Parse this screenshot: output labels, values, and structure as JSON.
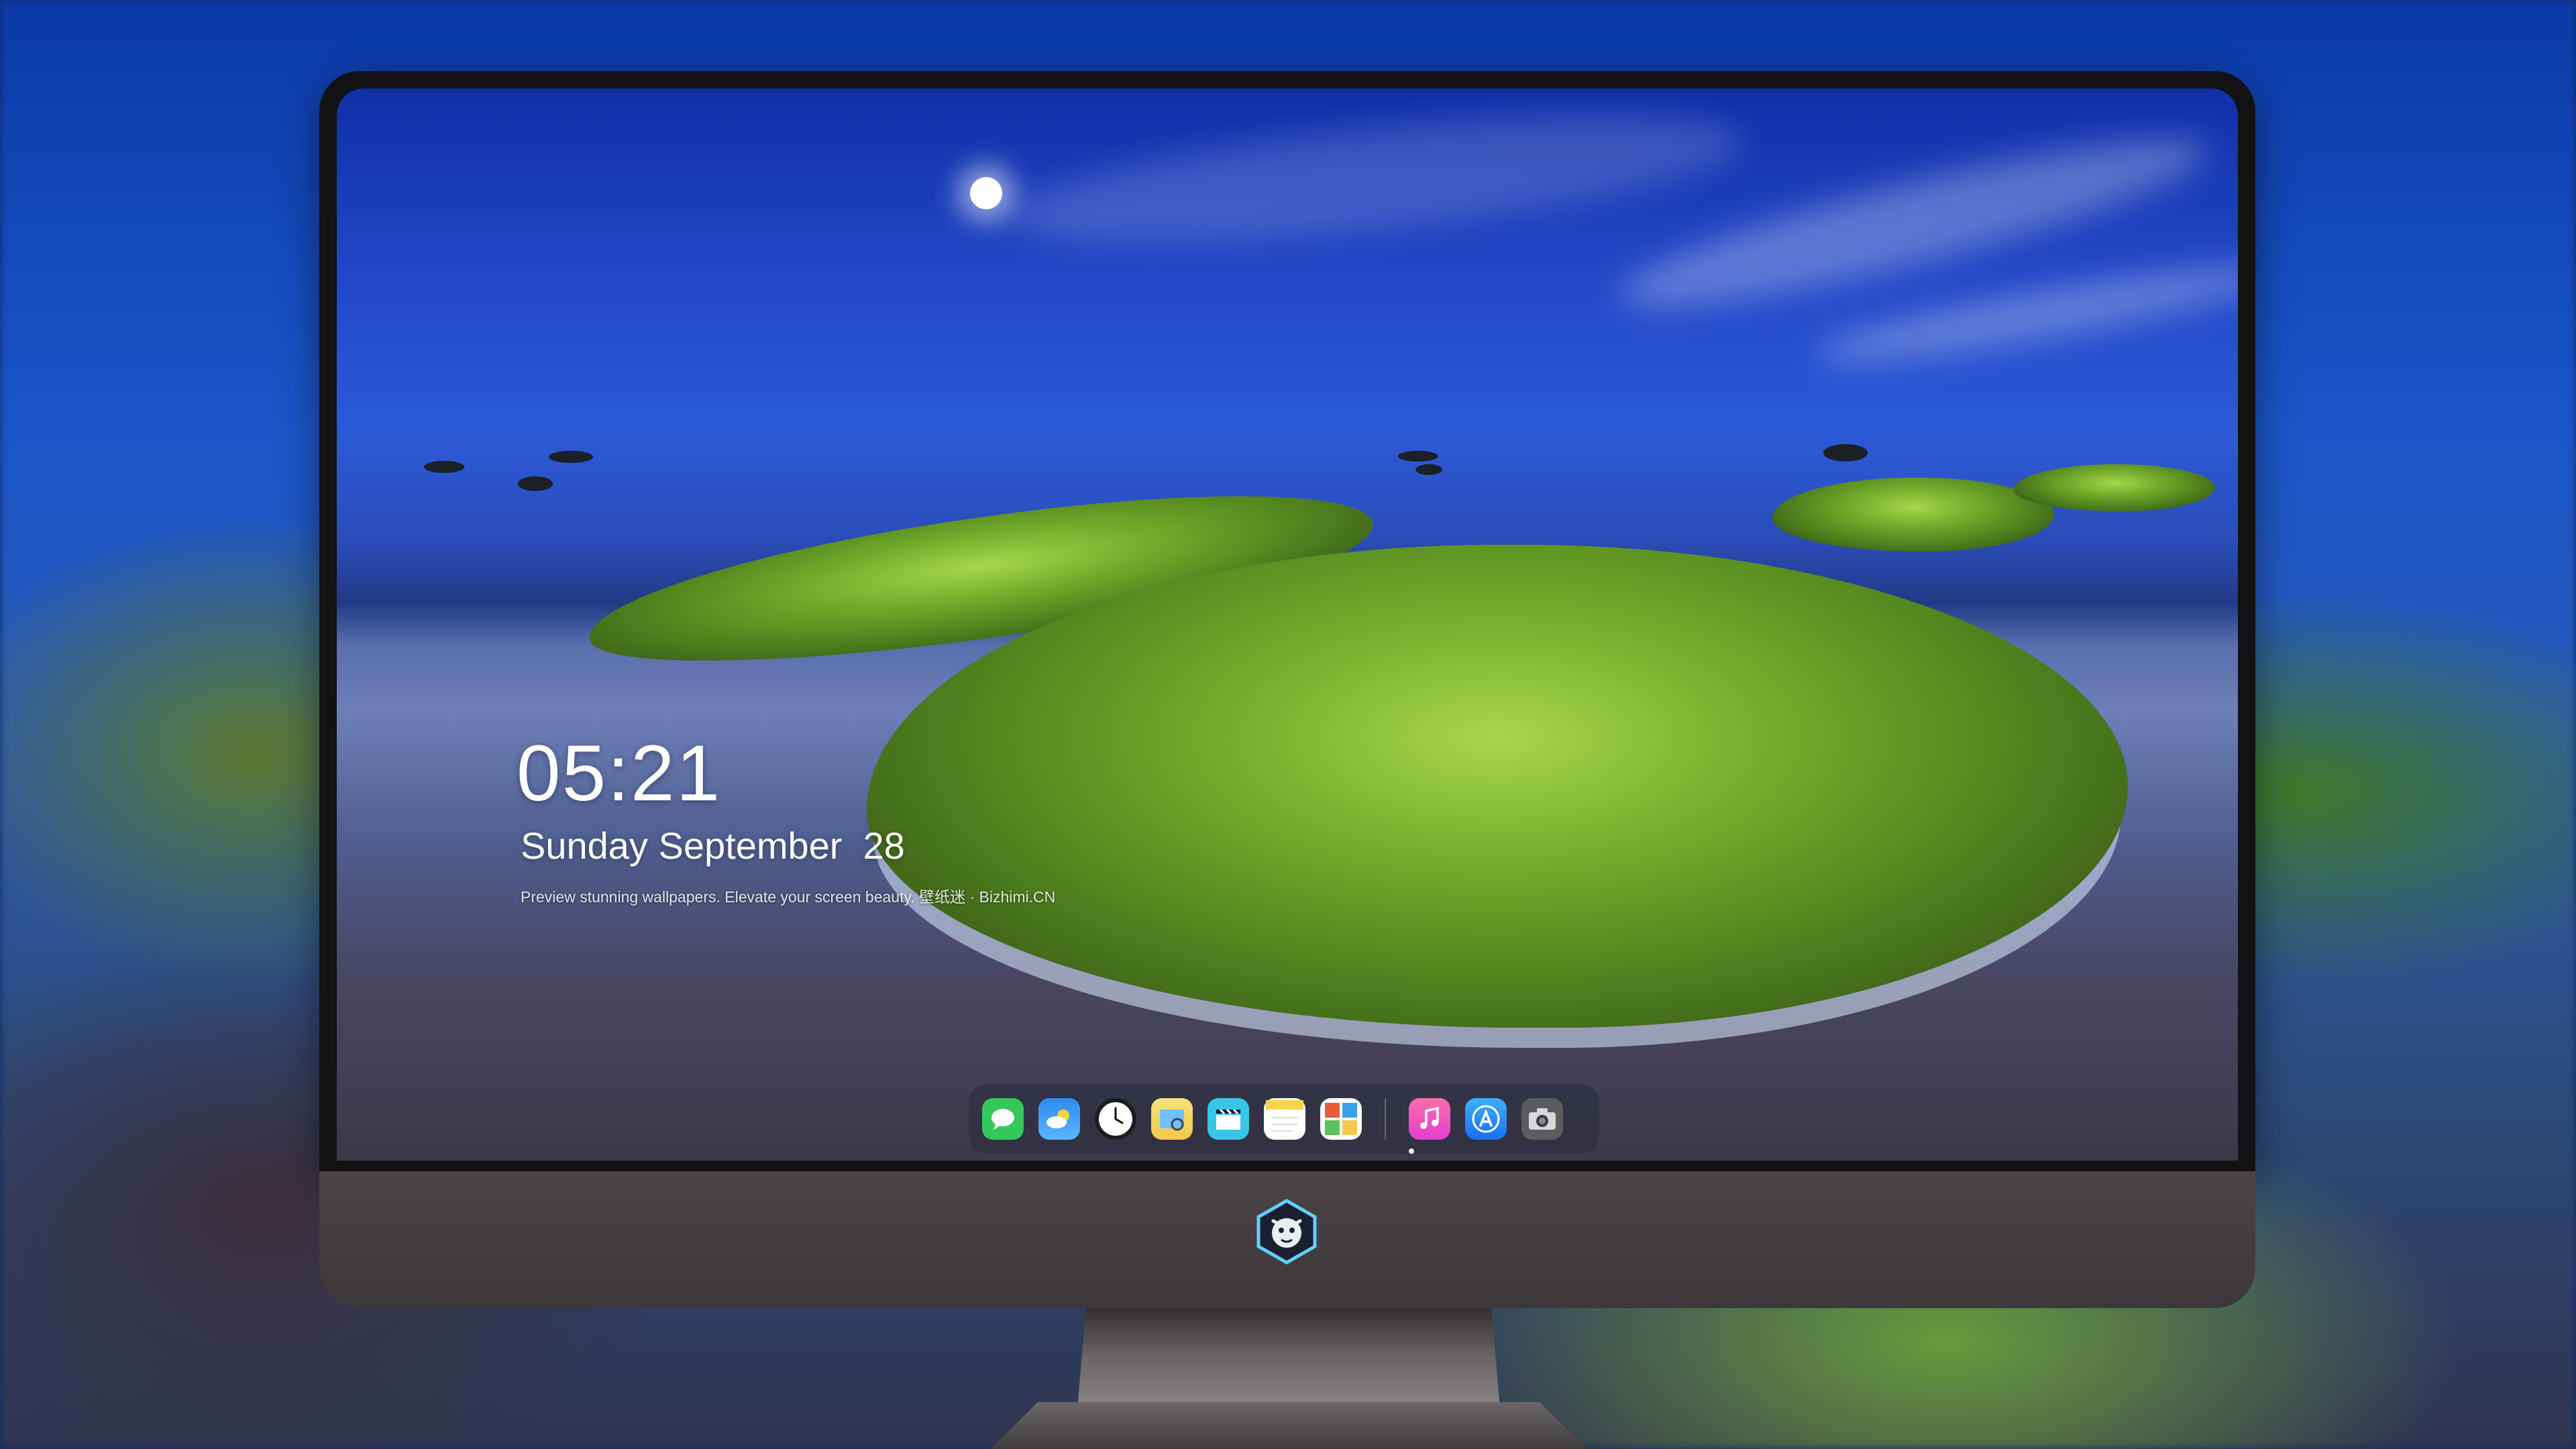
{
  "lockscreen": {
    "time": "05:21",
    "date": "Sunday September  28",
    "tagline": "Preview stunning wallpapers. Elevate your screen beauty. 壁纸迷 · Bizhimi.CN"
  },
  "dock": {
    "apps": [
      {
        "name": "messages-icon",
        "color": "#34c759"
      },
      {
        "name": "weather-icon",
        "color": "#2e8df0"
      },
      {
        "name": "clock-icon",
        "color": "#1c1c1e"
      },
      {
        "name": "preview-icon",
        "color": "#f2c94c"
      },
      {
        "name": "clips-icon",
        "color": "#38c6e8"
      },
      {
        "name": "notes-icon",
        "color": "#f7d54a"
      },
      {
        "name": "photo-booth-icon",
        "color": "#e85b3a"
      },
      {
        "name": "music-icon",
        "color": "#fc4f8c"
      },
      {
        "name": "app-store-icon",
        "color": "#1a8cf5"
      },
      {
        "name": "camera-icon",
        "color": "#5c5c60"
      }
    ]
  },
  "monitor": {
    "logo": "dragon-mascot-logo"
  }
}
